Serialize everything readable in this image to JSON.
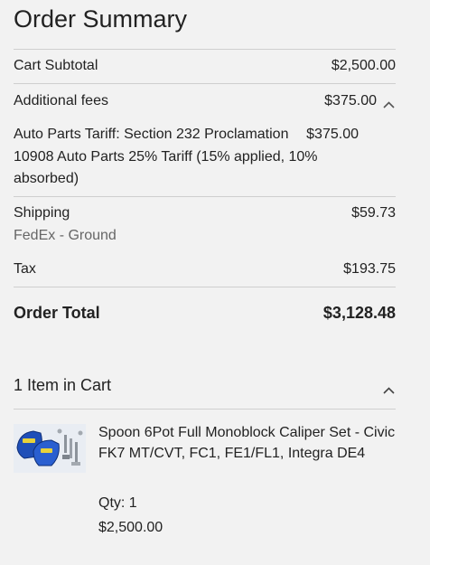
{
  "summary": {
    "title": "Order Summary",
    "subtotal_label": "Cart Subtotal",
    "subtotal_value": "$2,500.00",
    "fees_label": "Additional fees",
    "fees_value": "$375.00",
    "tariff_label": "Auto Parts Tariff: Section 232 Proclamation 10908 Auto Parts 25% Tariff (15% applied, 10% absorbed)",
    "tariff_value": "$375.00",
    "shipping_label": "Shipping",
    "shipping_method": "FedEx - Ground",
    "shipping_value": "$59.73",
    "tax_label": "Tax",
    "tax_value": "$193.75",
    "total_label": "Order Total",
    "total_value": "$3,128.48"
  },
  "cart": {
    "header": "1 Item in Cart",
    "item": {
      "name": "Spoon 6Pot Full Monoblock Caliper Set - Civic FK7 MT/CVT, FC1, FE1/FL1, Integra DE4",
      "qty": "Qty: 1",
      "price": "$2,500.00"
    }
  },
  "icons": {
    "fees_toggle": "chevron-up-icon",
    "cart_toggle": "chevron-up-icon"
  },
  "colors": {
    "panel_bg": "#f2f2f2",
    "caliper_blue": "#1f4fb8",
    "muted_text": "#666666"
  }
}
